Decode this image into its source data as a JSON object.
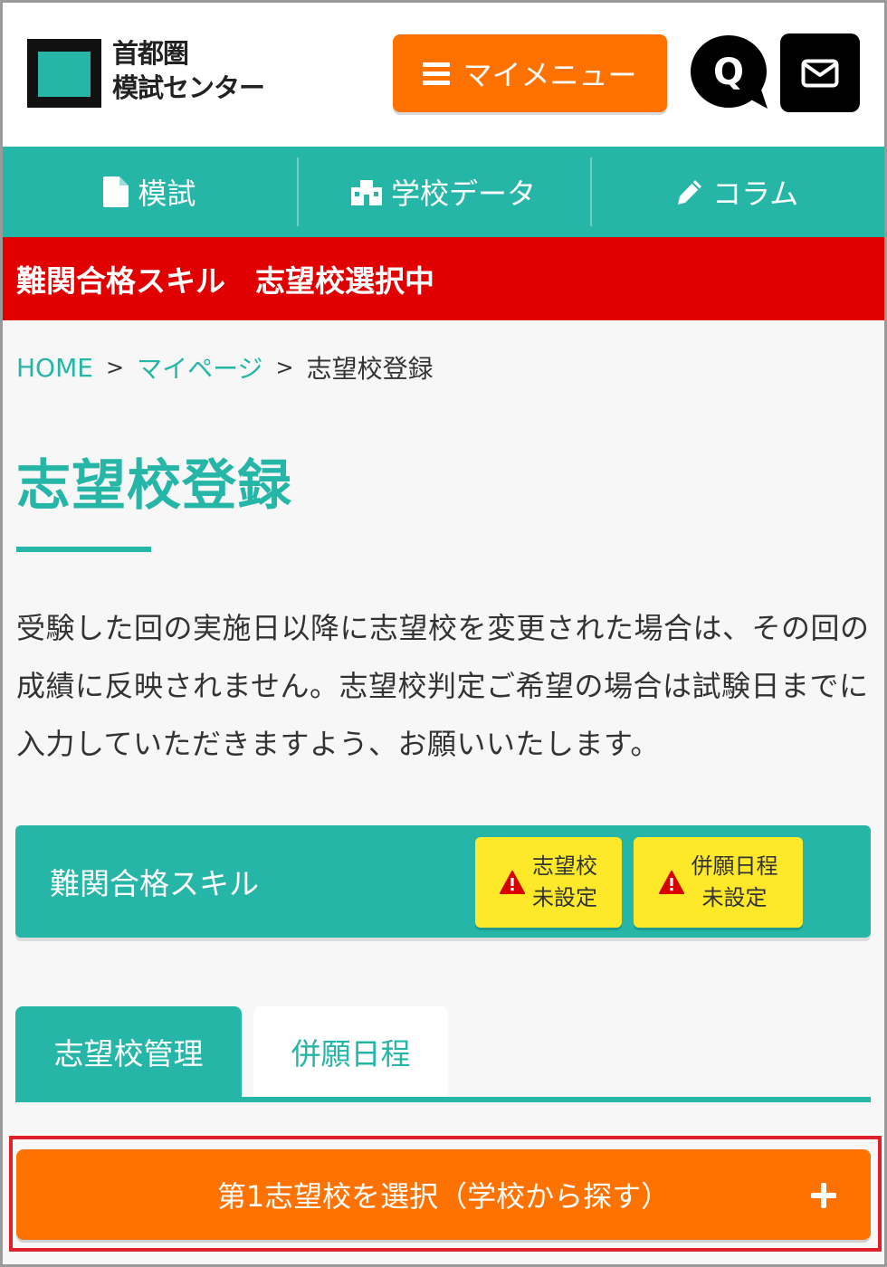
{
  "header": {
    "logo": {
      "line1": "首都圏",
      "line2": "模試センター"
    },
    "my_menu_label": "マイメニュー",
    "faq_label": "Q"
  },
  "nav": {
    "items": [
      {
        "label": "模試",
        "icon": "document-icon"
      },
      {
        "label": "学校データ",
        "icon": "school-icon"
      },
      {
        "label": "コラム",
        "icon": "pencil-icon"
      }
    ]
  },
  "banner": {
    "text": "難関合格スキル　志望校選択中"
  },
  "breadcrumb": {
    "home": "HOME",
    "mypage": "マイページ",
    "current": "志望校登録",
    "separator": ">"
  },
  "page": {
    "title": "志望校登録",
    "notice": "受験した回の実施日以降に志望校を変更された場合は、その回の成績に反映されません。志望校判定ご希望の場合は試験日までに入力していただきますよう、お願いいたします。"
  },
  "course": {
    "name": "難関合格スキル",
    "badges": [
      {
        "line1": "志望校",
        "line2": "未設定"
      },
      {
        "line1": "併願日程",
        "line2": "未設定"
      }
    ]
  },
  "tabs": [
    {
      "label": "志望校管理",
      "active": true
    },
    {
      "label": "併願日程",
      "active": false
    }
  ],
  "select_button": {
    "label": "第1志望校を選択（学校から探す）"
  },
  "colors": {
    "teal": "#26b6a8",
    "orange": "#ff7200",
    "red": "#e00000",
    "yellow": "#fde92a"
  }
}
